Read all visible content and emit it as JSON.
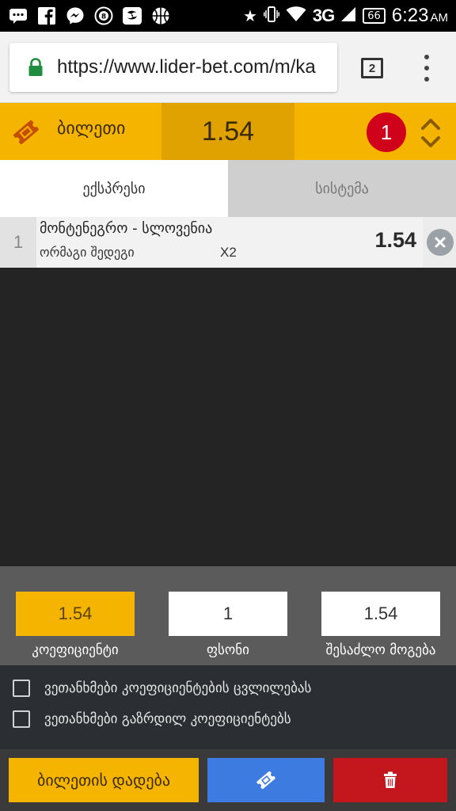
{
  "status_bar": {
    "network": "3G",
    "battery": "66",
    "time": "6:23",
    "ampm": "AM"
  },
  "browser": {
    "url": "https://www.lider-bet.com/m/ka",
    "tab_count": "2"
  },
  "ticket": {
    "title": "ბილეთი",
    "total_odds": "1.54",
    "bet_count": "1"
  },
  "tabs": [
    {
      "label": "ექსპრესი",
      "active": true
    },
    {
      "label": "სისტემა",
      "active": false
    }
  ],
  "bets": [
    {
      "index": "1",
      "event": "მონტენეგრო - სლოვენია",
      "market": "ორმაგი შედეგი",
      "pick": "X2",
      "odds": "1.54"
    }
  ],
  "summary": {
    "coefficient_value": "1.54",
    "coefficient_label": "კოეფიციენტი",
    "stake_value": "1",
    "stake_label": "ფსონი",
    "win_value": "1.54",
    "win_label": "შესაძლო მოგება"
  },
  "options": [
    {
      "label": "ვეთანხმები კოეფიციენტების ცვლილებას",
      "checked": false
    },
    {
      "label": "ვეთანხმები გაზრდილ კოეფიციენტებს",
      "checked": false
    }
  ],
  "actions": {
    "place_label": "ბილეთის დადება"
  },
  "colors": {
    "accent": "#f5b400",
    "accent_dark": "#e0a200",
    "badge": "#d0021b",
    "blue_button": "#3d7be0",
    "red_button": "#c4171d"
  }
}
